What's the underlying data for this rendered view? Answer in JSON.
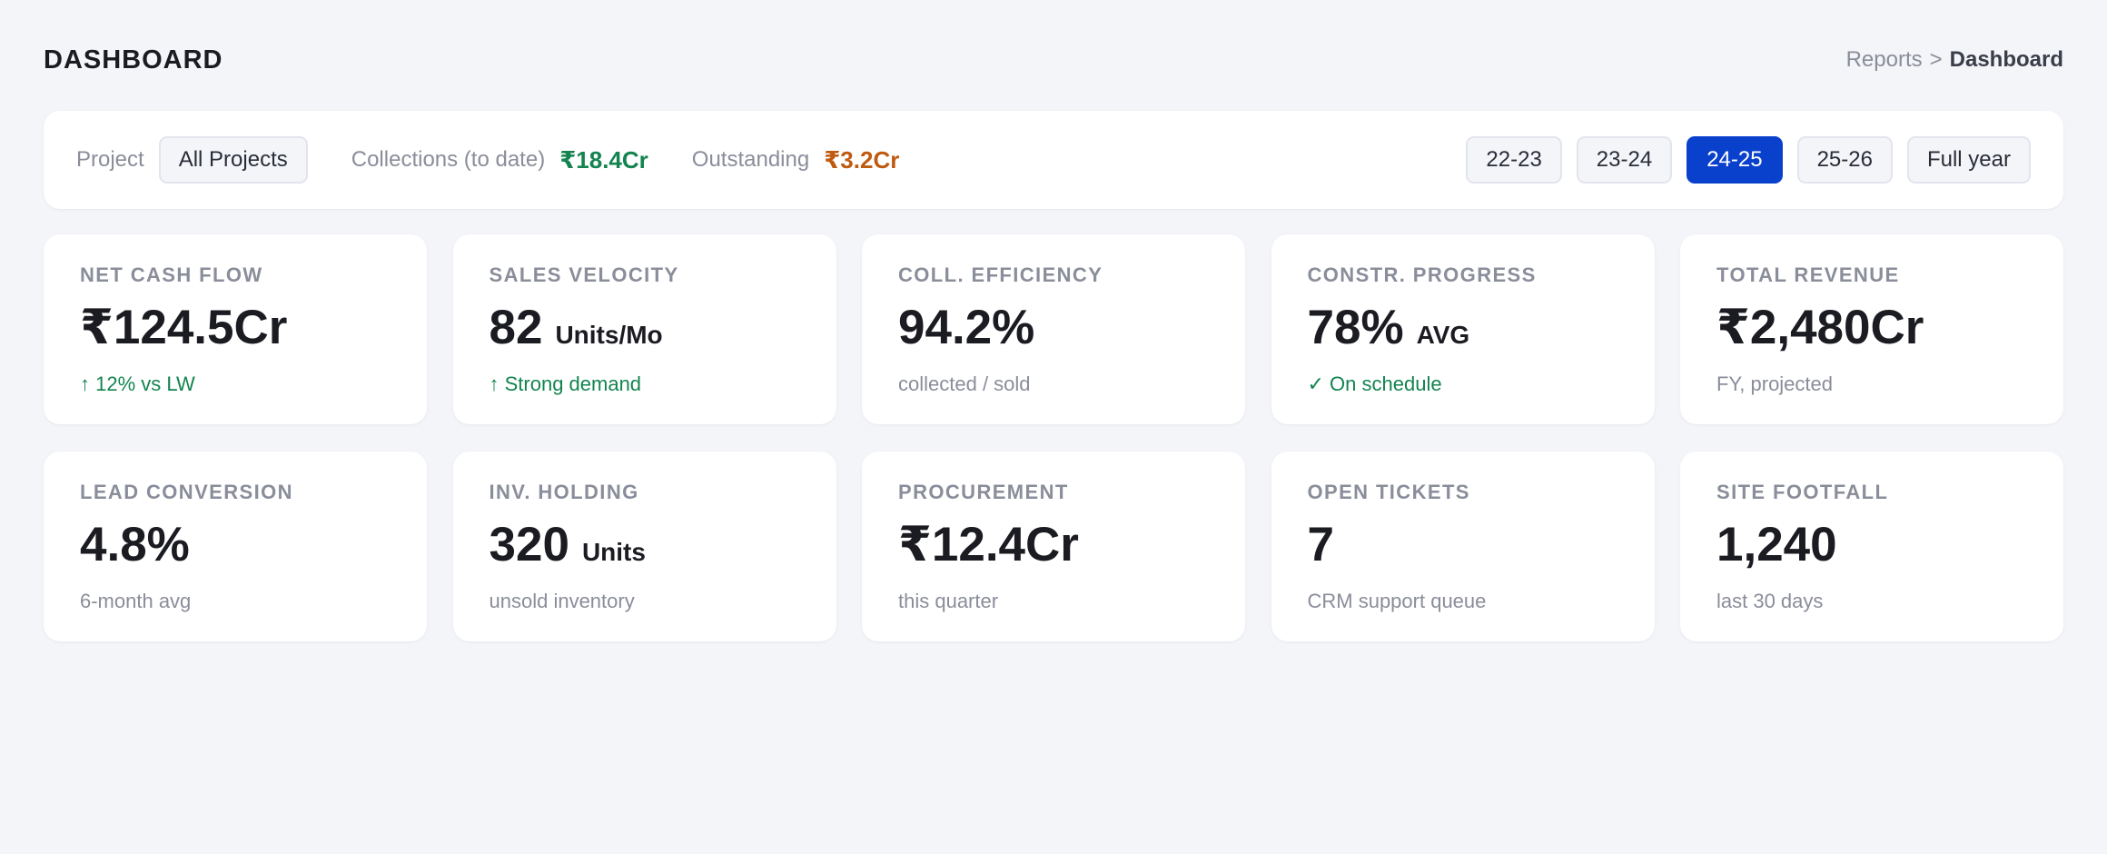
{
  "header": {
    "title": "DASHBOARD",
    "breadcrumb": {
      "parent": "Reports",
      "separator": ">",
      "current": "Dashboard"
    }
  },
  "filters": {
    "project_label": "Project",
    "project_value": "All Projects",
    "collections_label": "Collections (to date)",
    "collections_value": "₹18.4Cr",
    "outstanding_label": "Outstanding",
    "outstanding_value": "₹3.2Cr",
    "year_tabs": [
      "22-23",
      "23-24",
      "24-25",
      "25-26",
      "Full year"
    ],
    "active_year": "24-25"
  },
  "colors": {
    "accent": "#0a41cc",
    "positive": "#13844f",
    "warning": "#bf5a10",
    "background": "#f4f5f9"
  },
  "cards": [
    {
      "label": "NET CASH FLOW",
      "value": "₹124.5Cr",
      "unit": "",
      "sub": "↑ 12% vs LW",
      "trend": "positive"
    },
    {
      "label": "SALES VELOCITY",
      "value": "82",
      "unit": "Units/Mo",
      "sub": "↑ Strong demand",
      "trend": "positive"
    },
    {
      "label": "COLL. EFFICIENCY",
      "value": "94.2%",
      "unit": "",
      "sub": "collected / sold",
      "trend": "neutral"
    },
    {
      "label": "CONSTR. PROGRESS",
      "value": "78%",
      "unit": "AVG",
      "sub": "✓ On schedule",
      "trend": "positive"
    },
    {
      "label": "TOTAL REVENUE",
      "value": "₹2,480Cr",
      "unit": "",
      "sub": "FY, projected",
      "trend": "neutral"
    },
    {
      "label": "LEAD CONVERSION",
      "value": "4.8%",
      "unit": "",
      "sub": "6-month avg",
      "trend": "neutral"
    },
    {
      "label": "INV. HOLDING",
      "value": "320",
      "unit": "Units",
      "sub": "unsold inventory",
      "trend": "neutral"
    },
    {
      "label": "PROCUREMENT",
      "value": "₹12.4Cr",
      "unit": "",
      "sub": "this quarter",
      "trend": "neutral"
    },
    {
      "label": "OPEN TICKETS",
      "value": "7",
      "unit": "",
      "sub": "CRM support queue",
      "trend": "neutral"
    },
    {
      "label": "SITE FOOTFALL",
      "value": "1,240",
      "unit": "",
      "sub": "last 30 days",
      "trend": "neutral"
    }
  ]
}
